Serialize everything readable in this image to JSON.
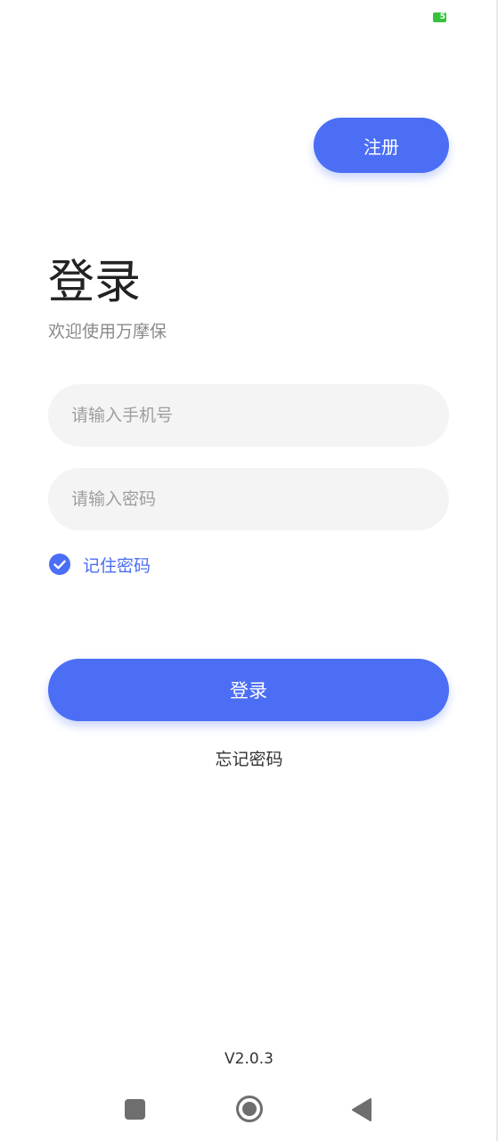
{
  "status_bar": {
    "battery_level": "5",
    "battery_icon": "battery-icon",
    "battery_color": "#37c23e"
  },
  "header": {
    "register_label": "注册"
  },
  "login": {
    "title": "登录",
    "subtitle": "欢迎使用万摩保",
    "phone_placeholder": "请输入手机号",
    "phone_value": "",
    "password_placeholder": "请输入密码",
    "password_value": "",
    "remember_checked": true,
    "remember_label": "记住密码",
    "submit_label": "登录",
    "forgot_label": "忘记密码"
  },
  "footer": {
    "version": "V2.0.3"
  },
  "nav_bar": {
    "recent_icon": "square-icon",
    "home_icon": "circle-home-icon",
    "back_icon": "triangle-back-icon"
  },
  "colors": {
    "accent": "#4b6ef5",
    "input_background": "#f4f4f4",
    "placeholder": "#9e9e9e",
    "subtitle": "#8a8a8a",
    "text": "#333333"
  }
}
